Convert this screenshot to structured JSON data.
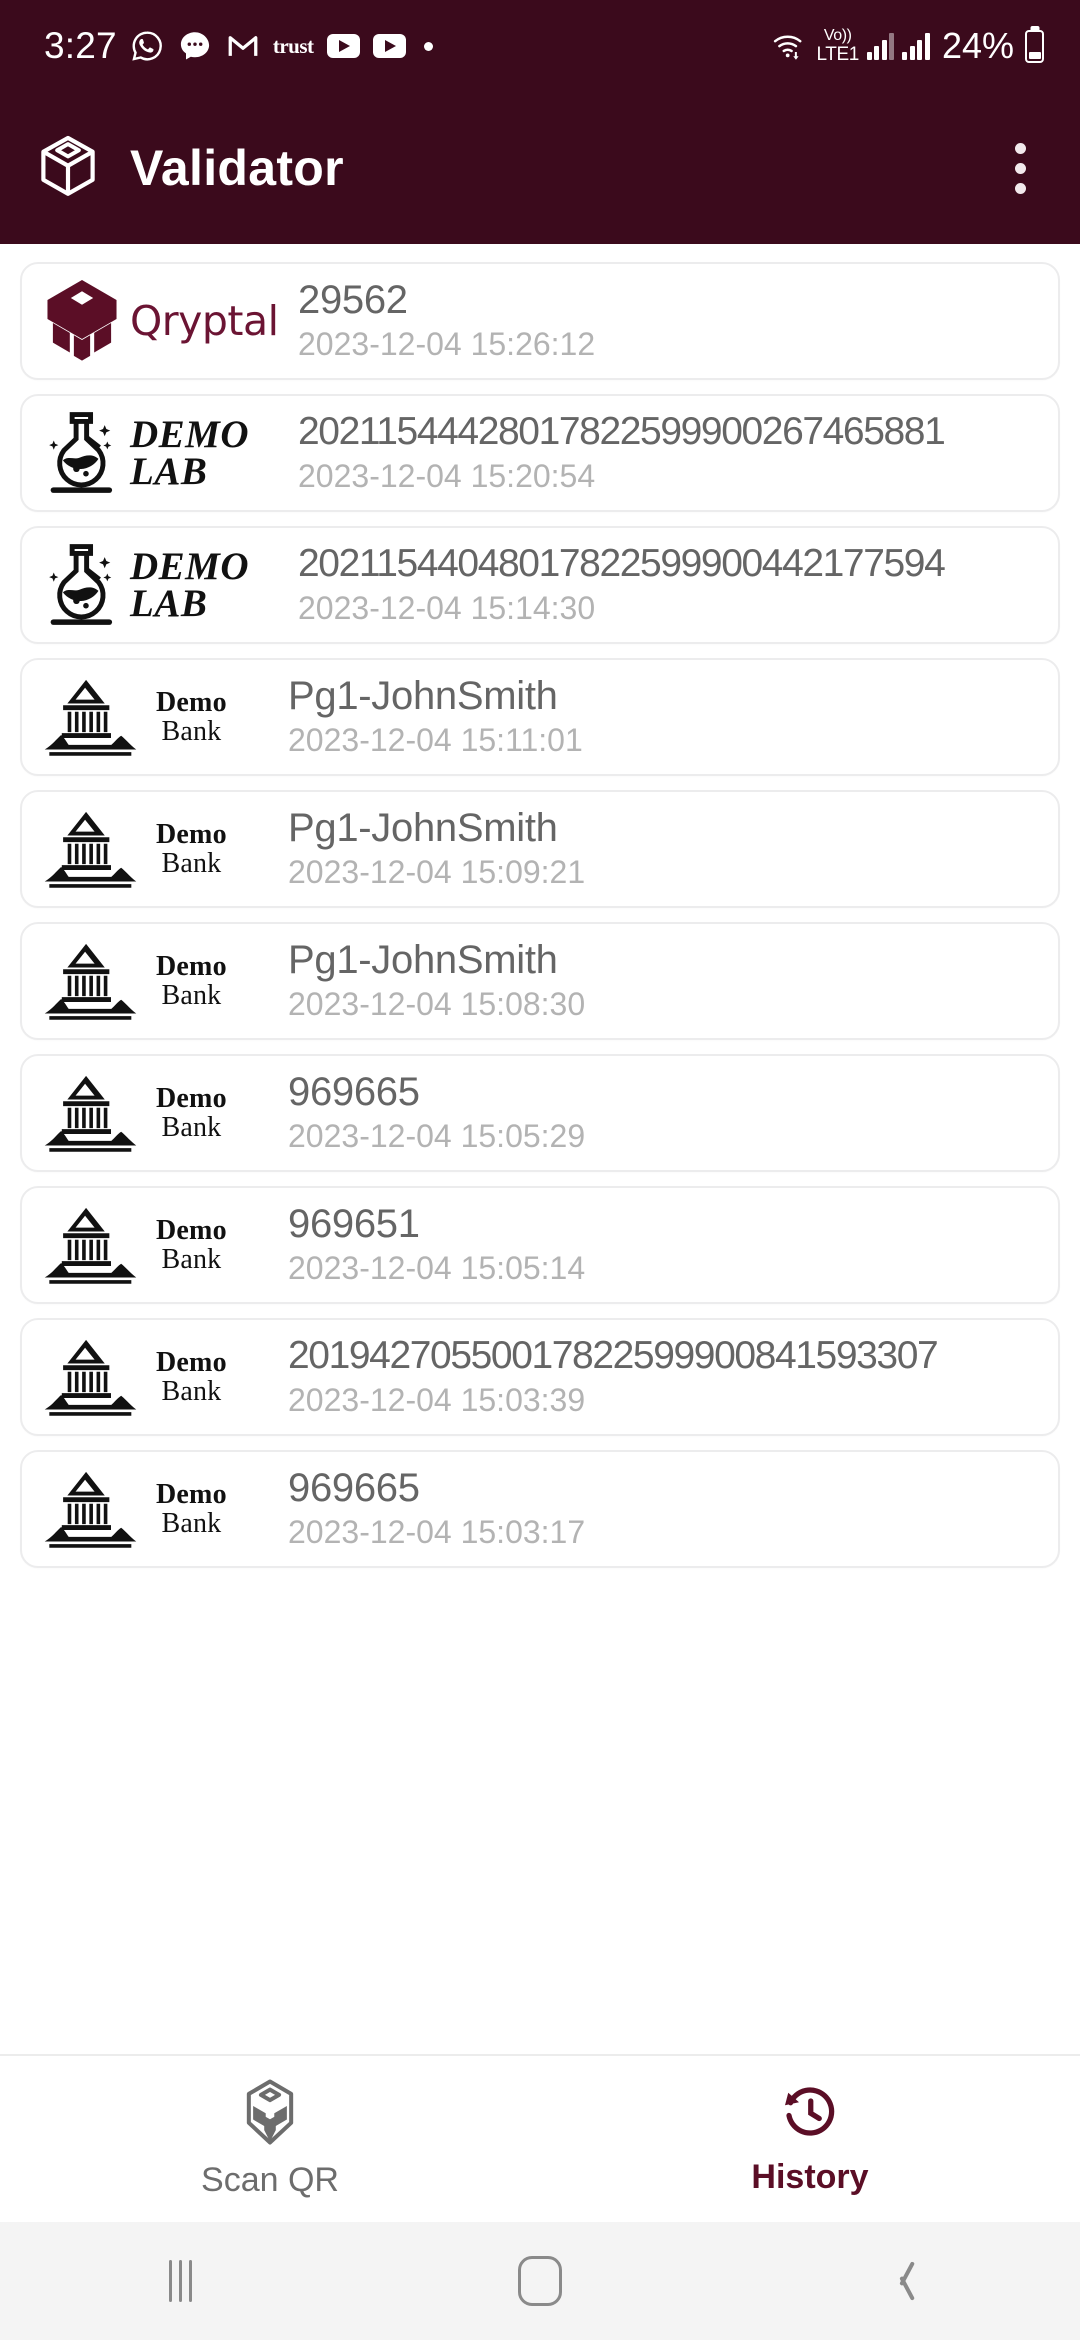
{
  "status_bar": {
    "time": "3:27",
    "battery_percent": "24%",
    "network_label_top": "Vo))",
    "network_label_bottom": "LTE1",
    "trust_label": "trust",
    "icons": [
      "whatsapp-icon",
      "messages-icon",
      "gmail-icon",
      "trust-wallet-icon",
      "youtube-icon",
      "youtube-music-icon",
      "notification-dot-icon",
      "wifi-icon",
      "volte-icon",
      "signal-bars-icon",
      "signal-bars-2-icon",
      "battery-icon"
    ],
    "background": "#3B0A1C"
  },
  "app_bar": {
    "title": "Validator",
    "logo_icon": "cube-outline-icon",
    "menu_icon": "overflow-menu-icon",
    "background": "#3B0A1C",
    "text_color": "#FFFFFF"
  },
  "history": {
    "items": [
      {
        "issuer": "Qryptal",
        "issuer_logo": "qryptal-cube-logo",
        "code": "29562",
        "timestamp": "2023-12-04 15:26:12"
      },
      {
        "issuer": "DEMO LAB",
        "issuer_logo": "demo-lab-flask-logo",
        "code": "20211544428017822599900267465881",
        "timestamp": "2023-12-04 15:20:54"
      },
      {
        "issuer": "DEMO LAB",
        "issuer_logo": "demo-lab-flask-logo",
        "code": "20211544048017822599900442177594",
        "timestamp": "2023-12-04 15:14:30"
      },
      {
        "issuer": "Demo Bank",
        "issuer_logo": "demo-bank-building-logo",
        "code": "Pg1-JohnSmith",
        "timestamp": "2023-12-04 15:11:01"
      },
      {
        "issuer": "Demo Bank",
        "issuer_logo": "demo-bank-building-logo",
        "code": "Pg1-JohnSmith",
        "timestamp": "2023-12-04 15:09:21"
      },
      {
        "issuer": "Demo Bank",
        "issuer_logo": "demo-bank-building-logo",
        "code": "Pg1-JohnSmith",
        "timestamp": "2023-12-04 15:08:30"
      },
      {
        "issuer": "Demo Bank",
        "issuer_logo": "demo-bank-building-logo",
        "code": "969665",
        "timestamp": "2023-12-04 15:05:29"
      },
      {
        "issuer": "Demo Bank",
        "issuer_logo": "demo-bank-building-logo",
        "code": "969651",
        "timestamp": "2023-12-04 15:05:14"
      },
      {
        "issuer": "Demo Bank",
        "issuer_logo": "demo-bank-building-logo",
        "code": "20194270550017822599900841593307",
        "timestamp": "2023-12-04 15:03:39"
      },
      {
        "issuer": "Demo Bank",
        "issuer_logo": "demo-bank-building-logo",
        "code": "969665",
        "timestamp": "2023-12-04 15:03:17"
      }
    ],
    "demolab_line1": "DEMO",
    "demolab_line2": "LAB",
    "demobank_line1": "Demo",
    "demobank_line2": "Bank",
    "qryptal_word": "Qryptal"
  },
  "bottom_nav": {
    "items": [
      {
        "label": "Scan QR",
        "icon": "cube-scan-icon",
        "active": false
      },
      {
        "label": "History",
        "icon": "history-clock-icon",
        "active": true
      }
    ],
    "active_color": "#5B0E26",
    "inactive_color": "#6D6D6D"
  },
  "system_nav": {
    "recents_icon": "recents-icon",
    "home_icon": "home-icon",
    "back_icon": "back-icon"
  }
}
